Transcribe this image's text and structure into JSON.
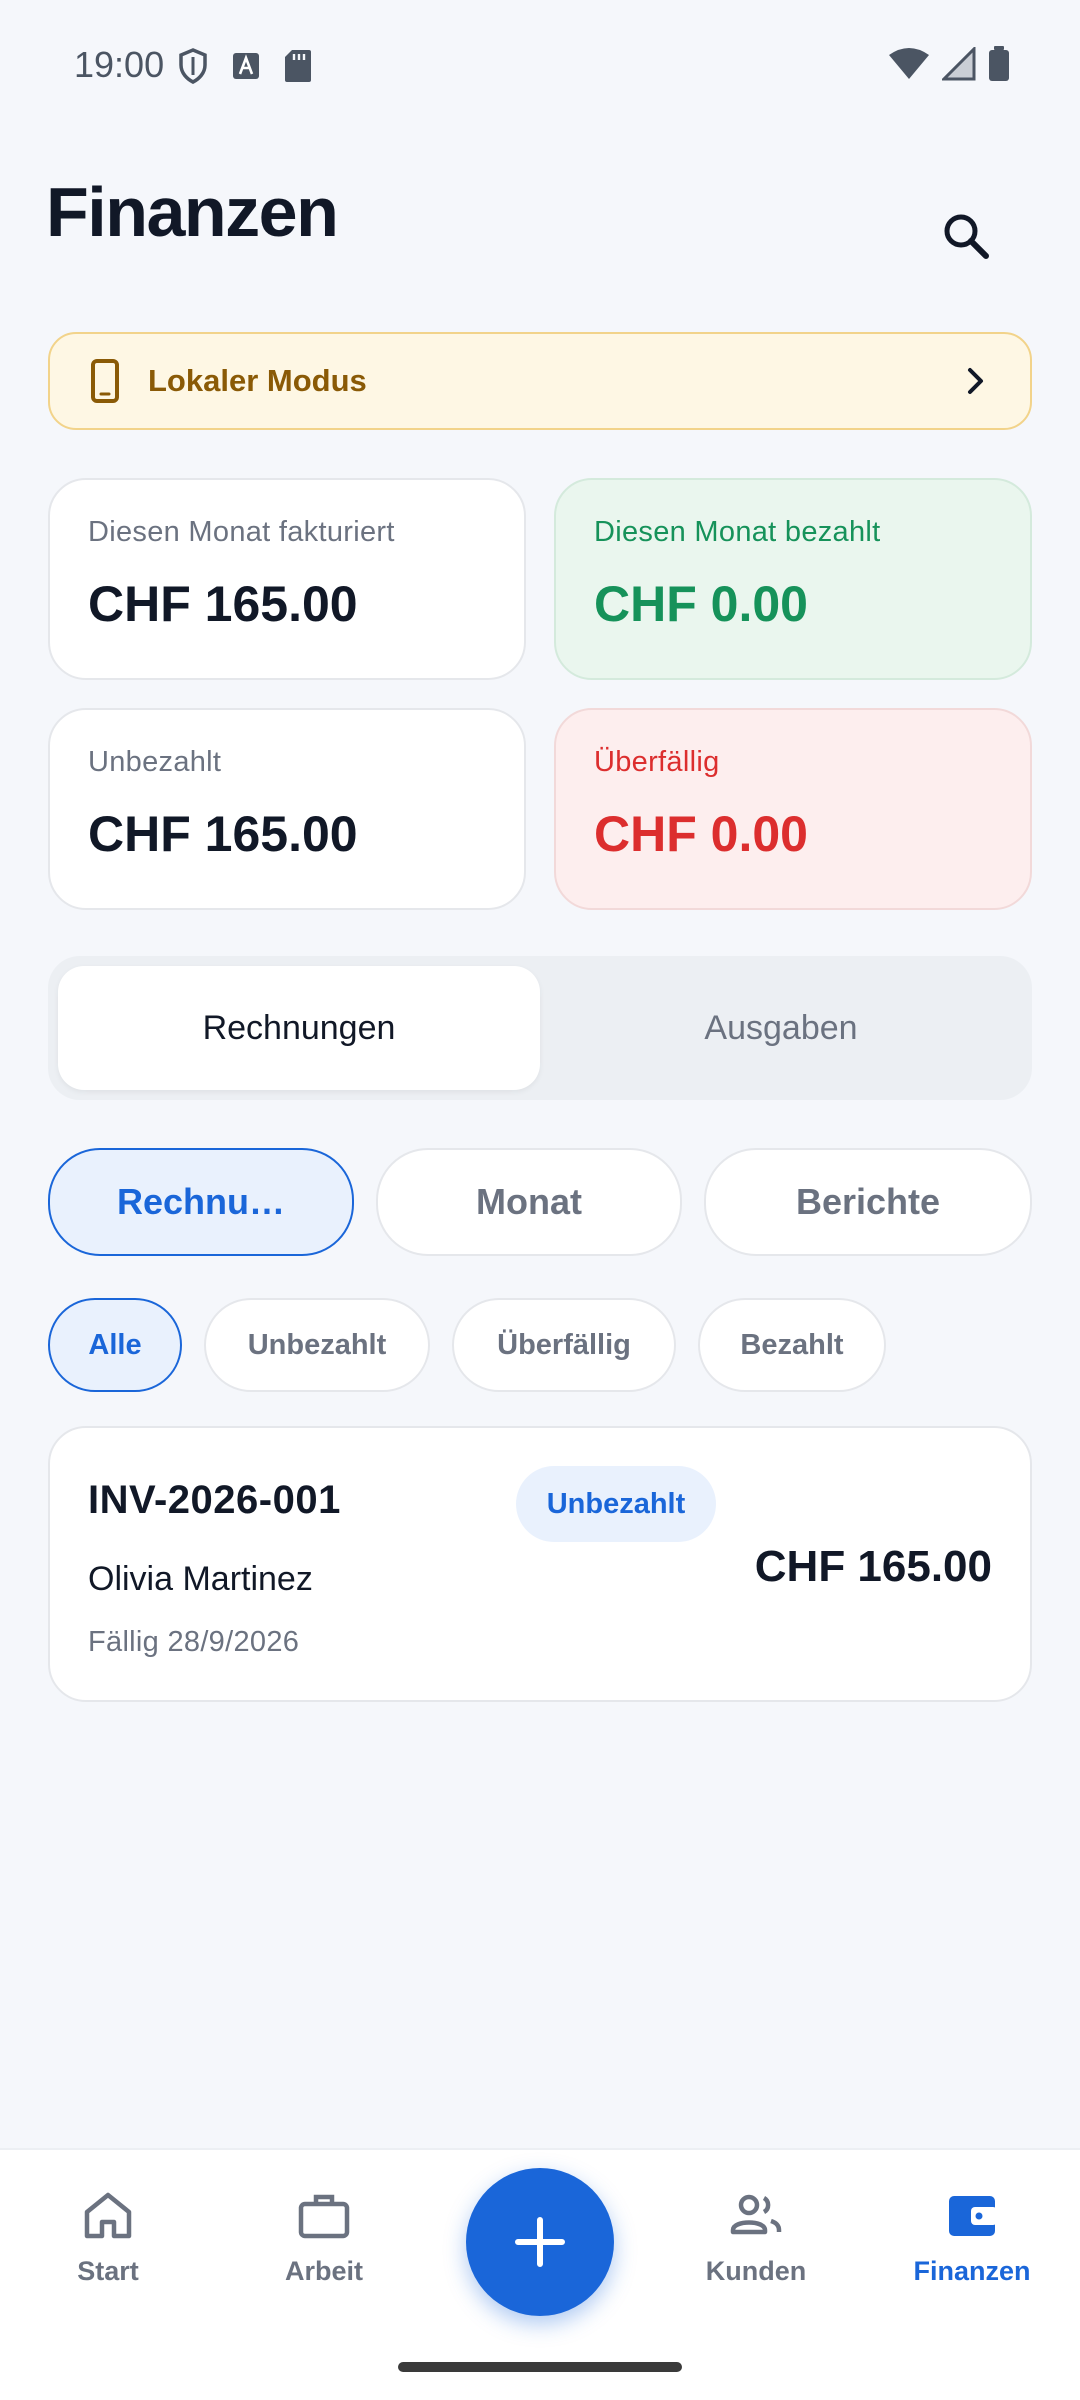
{
  "status_bar": {
    "time": "19:00",
    "left_icons": [
      "shield-icon",
      "font-a-icon",
      "sd-card-icon"
    ],
    "right_icons": [
      "wifi-icon",
      "signal-icon",
      "battery-icon"
    ]
  },
  "header": {
    "title": "Finanzen",
    "search_icon": "search-icon"
  },
  "banner": {
    "icon": "phone-icon",
    "label": "Lokaler Modus",
    "chevron": "chevron-right-icon"
  },
  "stats": [
    {
      "caption": "Diesen Monat fakturiert",
      "value": "CHF 165.00",
      "tone": "neutral"
    },
    {
      "caption": "Diesen Monat bezahlt",
      "value": "CHF 0.00",
      "tone": "green"
    },
    {
      "caption": "Unbezahlt",
      "value": "CHF 165.00",
      "tone": "neutral"
    },
    {
      "caption": "Überfällig",
      "value": "CHF 0.00",
      "tone": "red"
    }
  ],
  "segments": {
    "items": [
      "Rechnungen",
      "Ausgaben"
    ],
    "selected": "Rechnungen"
  },
  "views": {
    "items": [
      "Rechnu…",
      "Monat",
      "Berichte"
    ],
    "selected": "Rechnu…"
  },
  "filters": {
    "items": [
      "Alle",
      "Unbezahlt",
      "Überfällig",
      "Bezahlt"
    ],
    "selected": "Alle"
  },
  "invoices": [
    {
      "number": "INV-2026-001",
      "status": "Unbezahlt",
      "client": "Olivia Martinez",
      "due": "Fällig 28/9/2026",
      "amount": "CHF 165.00"
    }
  ],
  "bottom_nav": {
    "items": [
      {
        "label": "Start",
        "icon": "home-icon"
      },
      {
        "label": "Arbeit",
        "icon": "briefcase-icon"
      },
      {
        "label": "Kunden",
        "icon": "people-icon"
      },
      {
        "label": "Finanzen",
        "icon": "wallet-icon"
      }
    ],
    "active": "Finanzen",
    "fab_icon": "plus-icon"
  },
  "colors": {
    "accent": "#1a66d9",
    "paid_green": "#16925a",
    "overdue_red": "#dc2e2e",
    "banner_brown": "#8a5a06",
    "banner_bg": "#fef7e4"
  }
}
